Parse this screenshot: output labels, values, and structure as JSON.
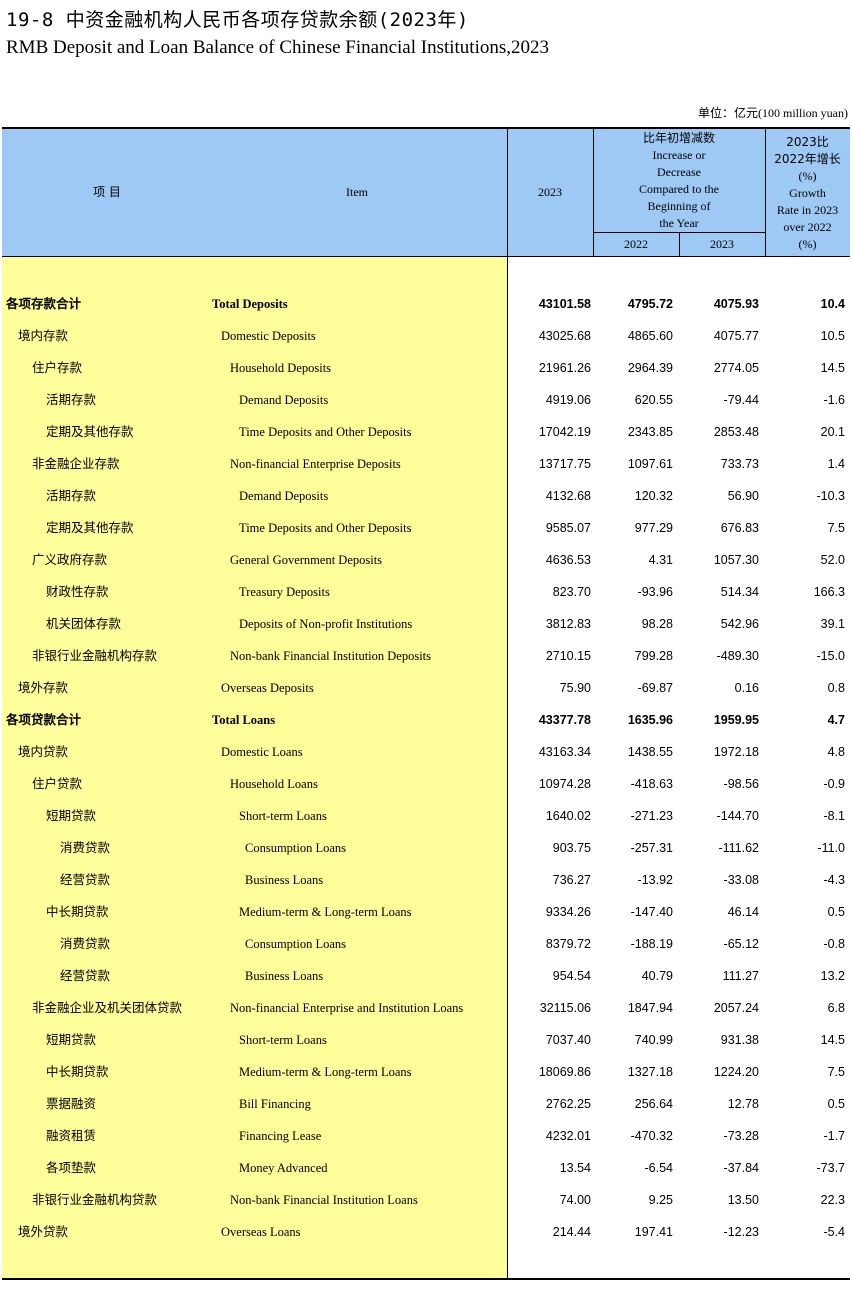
{
  "title_cn": "19-8  中资金融机构人民币各项存贷款余额(2023年)",
  "title_en": "RMB Deposit and Loan Balance of Chinese Financial Institutions,2023",
  "unit": "单位：亿元(100 million yuan)",
  "header": {
    "item_cn": "项  目",
    "item_en": "Item",
    "year": "2023",
    "increase_lines": [
      "比年初增减数",
      "Increase or",
      "Decrease",
      "Compared to the",
      "Beginning of",
      "the Year"
    ],
    "increase_2022": "2022",
    "increase_2023": "2023",
    "growth_lines": [
      "2023比",
      "2022年增长",
      "(%)",
      "Growth",
      "Rate in 2023",
      "over 2022",
      "(%)"
    ]
  },
  "rows": [
    {
      "cn": "各项存款合计",
      "en": "Total Deposits",
      "level": 0,
      "bold": true,
      "v2023": "43101.58",
      "i2022": "4795.72",
      "i2023": "4075.93",
      "growth": "10.4"
    },
    {
      "cn": "境内存款",
      "en": "Domestic Deposits",
      "level": 1,
      "bold": false,
      "v2023": "43025.68",
      "i2022": "4865.60",
      "i2023": "4075.77",
      "growth": "10.5"
    },
    {
      "cn": "住户存款",
      "en": "Household Deposits",
      "level": 2,
      "bold": false,
      "v2023": "21961.26",
      "i2022": "2964.39",
      "i2023": "2774.05",
      "growth": "14.5"
    },
    {
      "cn": "活期存款",
      "en": "Demand  Deposits",
      "level": 3,
      "bold": false,
      "v2023": "4919.06",
      "i2022": "620.55",
      "i2023": "-79.44",
      "growth": "-1.6"
    },
    {
      "cn": "定期及其他存款",
      "en": "Time Deposits and Other Deposits",
      "level": 3,
      "bold": false,
      "v2023": "17042.19",
      "i2022": "2343.85",
      "i2023": "2853.48",
      "growth": "20.1"
    },
    {
      "cn": "非金融企业存款",
      "en": "Non-financial Enterprise Deposits",
      "level": 2,
      "bold": false,
      "v2023": "13717.75",
      "i2022": "1097.61",
      "i2023": "733.73",
      "growth": "1.4"
    },
    {
      "cn": "活期存款",
      "en": "Demand  Deposits",
      "level": 3,
      "bold": false,
      "v2023": "4132.68",
      "i2022": "120.32",
      "i2023": "56.90",
      "growth": "-10.3"
    },
    {
      "cn": "定期及其他存款",
      "en": "Time Deposits and Other Deposits",
      "level": 3,
      "bold": false,
      "v2023": "9585.07",
      "i2022": "977.29",
      "i2023": "676.83",
      "growth": "7.5"
    },
    {
      "cn": "广义政府存款",
      "en": "General Government Deposits",
      "level": 2,
      "bold": false,
      "v2023": "4636.53",
      "i2022": "4.31",
      "i2023": "1057.30",
      "growth": "52.0"
    },
    {
      "cn": "财政性存款",
      "en": "Treasury Deposits",
      "level": 3,
      "bold": false,
      "v2023": "823.70",
      "i2022": "-93.96",
      "i2023": "514.34",
      "growth": "166.3"
    },
    {
      "cn": "机关团体存款",
      "en": "Deposits of Non-profit Institutions",
      "level": 3,
      "bold": false,
      "v2023": "3812.83",
      "i2022": "98.28",
      "i2023": "542.96",
      "growth": "39.1"
    },
    {
      "cn": "非银行业金融机构存款",
      "en": "Non-bank Financial Institution Deposits",
      "level": 2,
      "bold": false,
      "v2023": "2710.15",
      "i2022": "799.28",
      "i2023": "-489.30",
      "growth": "-15.0"
    },
    {
      "cn": "境外存款",
      "en": "Overseas Deposits",
      "level": 1,
      "bold": false,
      "v2023": "75.90",
      "i2022": "-69.87",
      "i2023": "0.16",
      "growth": "0.8"
    },
    {
      "cn": "各项贷款合计",
      "en": "Total Loans",
      "level": 0,
      "bold": true,
      "v2023": "43377.78",
      "i2022": "1635.96",
      "i2023": "1959.95",
      "growth": "4.7"
    },
    {
      "cn": "境内贷款",
      "en": "Domestic Loans",
      "level": 1,
      "bold": false,
      "v2023": "43163.34",
      "i2022": "1438.55",
      "i2023": "1972.18",
      "growth": "4.8"
    },
    {
      "cn": "住户贷款",
      "en": "Household Loans",
      "level": 2,
      "bold": false,
      "v2023": "10974.28",
      "i2022": "-418.63",
      "i2023": "-98.56",
      "growth": "-0.9"
    },
    {
      "cn": "短期贷款",
      "en": "Short-term Loans",
      "level": 3,
      "bold": false,
      "v2023": "1640.02",
      "i2022": "-271.23",
      "i2023": "-144.70",
      "growth": "-8.1"
    },
    {
      "cn": "消费贷款",
      "en": "Consumption Loans",
      "level": 4,
      "bold": false,
      "v2023": "903.75",
      "i2022": "-257.31",
      "i2023": "-111.62",
      "growth": "-11.0"
    },
    {
      "cn": "经营贷款",
      "en": "Business Loans",
      "level": 4,
      "bold": false,
      "v2023": "736.27",
      "i2022": "-13.92",
      "i2023": "-33.08",
      "growth": "-4.3"
    },
    {
      "cn": "中长期贷款",
      "en": "Medium-term & Long-term Loans",
      "level": 3,
      "bold": false,
      "v2023": "9334.26",
      "i2022": "-147.40",
      "i2023": "46.14",
      "growth": "0.5"
    },
    {
      "cn": "消费贷款",
      "en": "Consumption Loans",
      "level": 4,
      "bold": false,
      "v2023": "8379.72",
      "i2022": "-188.19",
      "i2023": "-65.12",
      "growth": "-0.8"
    },
    {
      "cn": "经营贷款",
      "en": "Business Loans",
      "level": 4,
      "bold": false,
      "v2023": "954.54",
      "i2022": "40.79",
      "i2023": "111.27",
      "growth": "13.2"
    },
    {
      "cn": "非金融企业及机关团体贷款",
      "en": "Non-financial Enterprise and Institution Loans",
      "level": 2,
      "bold": false,
      "v2023": "32115.06",
      "i2022": "1847.94",
      "i2023": "2057.24",
      "growth": "6.8"
    },
    {
      "cn": "短期贷款",
      "en": "Short-term Loans",
      "level": 3,
      "bold": false,
      "v2023": "7037.40",
      "i2022": "740.99",
      "i2023": "931.38",
      "growth": "14.5"
    },
    {
      "cn": "中长期贷款",
      "en": "Medium-term & Long-term Loans",
      "level": 3,
      "bold": false,
      "v2023": "18069.86",
      "i2022": "1327.18",
      "i2023": "1224.20",
      "growth": "7.5"
    },
    {
      "cn": "票据融资",
      "en": "Bill Financing",
      "level": 3,
      "bold": false,
      "v2023": "2762.25",
      "i2022": "256.64",
      "i2023": "12.78",
      "growth": "0.5"
    },
    {
      "cn": "融资租赁",
      "en": "Financing Lease",
      "level": 3,
      "bold": false,
      "v2023": "4232.01",
      "i2022": "-470.32",
      "i2023": "-73.28",
      "growth": "-1.7"
    },
    {
      "cn": "各项垫款",
      "en": "Money Advanced",
      "level": 3,
      "bold": false,
      "v2023": "13.54",
      "i2022": "-6.54",
      "i2023": "-37.84",
      "growth": "-73.7"
    },
    {
      "cn": "非银行业金融机构贷款",
      "en": "Non-bank Financial Institution Loans",
      "level": 2,
      "bold": false,
      "v2023": "74.00",
      "i2022": "9.25",
      "i2023": "13.50",
      "growth": "22.3"
    },
    {
      "cn": "境外贷款",
      "en": "Overseas Loans",
      "level": 1,
      "bold": false,
      "v2023": "214.44",
      "i2022": "197.41",
      "i2023": "-12.23",
      "growth": "-5.4"
    }
  ]
}
